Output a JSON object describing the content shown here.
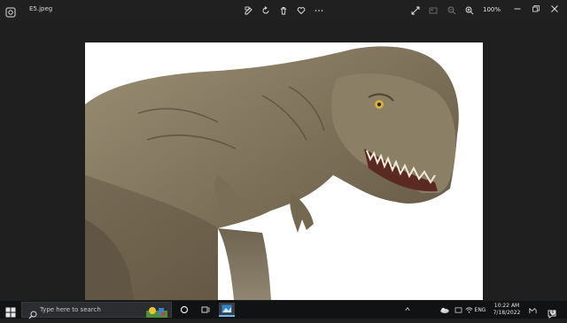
{
  "titlebar": {
    "file_name": "E5.jpeg",
    "zoom_level": "100%",
    "icons": [
      "photos-app-icon",
      "edit-icon",
      "rotate-icon",
      "delete-icon",
      "favorite-icon",
      "more-icon",
      "fullscreen-icon",
      "slideshow-icon",
      "zoom-out-icon",
      "zoom-in-icon",
      "minimize-icon",
      "restore-icon",
      "close-icon"
    ]
  },
  "image": {
    "description_alt": "",
    "background_color": "#ffffff"
  },
  "taskbar": {
    "search_placeholder": "Type here to search",
    "apps": [
      "cortana-icon",
      "task-view-icon",
      "photos-taskbar-icon"
    ],
    "tray": {
      "language": "ENG",
      "time": "10:22 AM",
      "date": "7/18/2022",
      "notification_count": "6"
    }
  },
  "colors": {
    "accent": "#6ab7ff",
    "titlebar_bg": "#202020",
    "viewer_bg": "#1f1f1f",
    "taskbar_bg": "#101214"
  }
}
